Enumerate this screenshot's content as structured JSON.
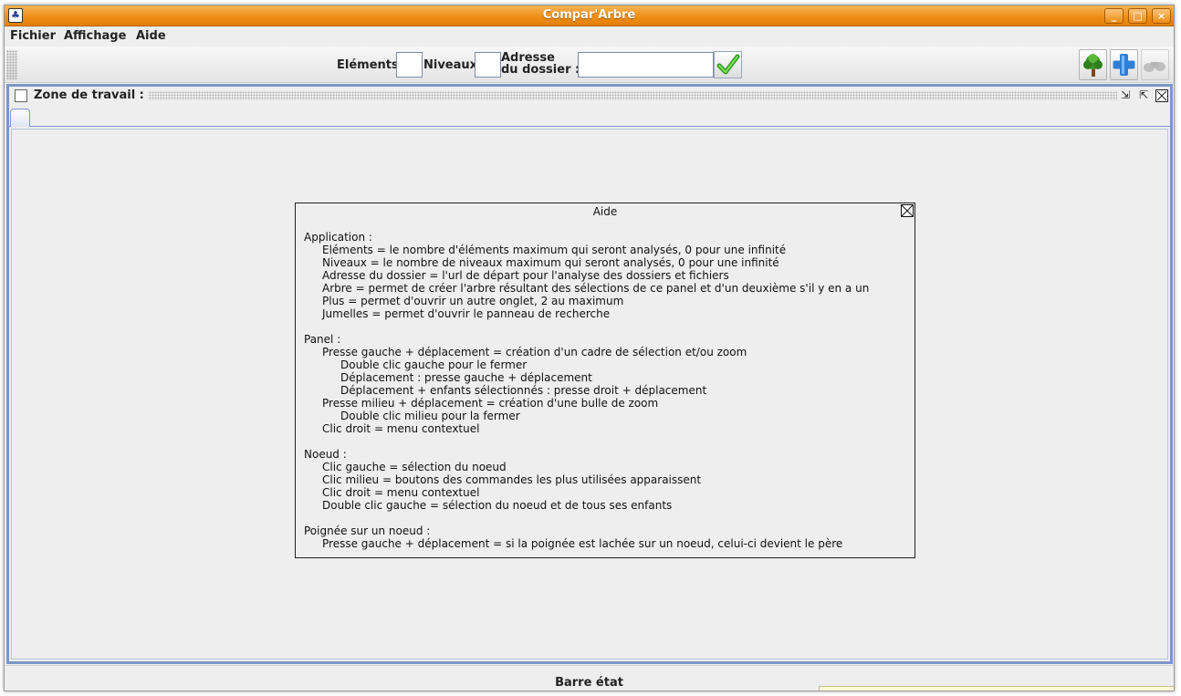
{
  "window": {
    "title": "Compar'Arbre",
    "controls": {
      "minimize": "_",
      "maximize": "□",
      "close": "×"
    }
  },
  "menubar": {
    "items": [
      {
        "label": "Fichier"
      },
      {
        "label": "Affichage"
      },
      {
        "label": "Aide"
      }
    ]
  },
  "toolbar": {
    "elements_label": "Eléments",
    "elements_value": "",
    "niveaux_label": "Niveaux",
    "niveaux_value": "",
    "adresse_label_line1": "Adresse",
    "adresse_label_line2": "du dossier :",
    "adresse_value": "",
    "validate_icon": "check-icon",
    "buttons": [
      {
        "name": "tree-icon"
      },
      {
        "name": "plus-icon"
      },
      {
        "name": "binoculars-icon"
      }
    ]
  },
  "workzone": {
    "title": "Zone de travail :"
  },
  "help_dialog": {
    "title": "Aide",
    "sections": [
      {
        "heading": "Application :",
        "lines": [
          {
            "level": 1,
            "text": "Eléments = le nombre d'éléments maximum qui seront analysés, 0 pour une infinité"
          },
          {
            "level": 1,
            "text": "Niveaux = le nombre de niveaux maximum qui seront analysés, 0 pour une infinité"
          },
          {
            "level": 1,
            "text": "Adresse du dossier = l'url de départ pour l'analyse des dossiers et fichiers"
          },
          {
            "level": 1,
            "text": "Arbre = permet de créer l'arbre résultant des sélections de ce panel et d'un deuxième s'il y en a un"
          },
          {
            "level": 1,
            "text": "Plus = permet d'ouvrir un autre onglet, 2 au maximum"
          },
          {
            "level": 1,
            "text": "Jumelles = permet d'ouvrir le panneau de recherche"
          }
        ]
      },
      {
        "heading": "Panel :",
        "lines": [
          {
            "level": 1,
            "text": "Presse gauche + déplacement = création d'un cadre de sélection et/ou zoom"
          },
          {
            "level": 2,
            "text": "Double clic gauche pour le fermer"
          },
          {
            "level": 2,
            "text": "Déplacement : presse gauche + déplacement"
          },
          {
            "level": 2,
            "text": "Déplacement + enfants sélectionnés : presse droit + déplacement"
          },
          {
            "level": 1,
            "text": "Presse milieu + déplacement = création d'une bulle de zoom"
          },
          {
            "level": 2,
            "text": "Double clic milieu pour la fermer"
          },
          {
            "level": 1,
            "text": "Clic droit = menu contextuel"
          }
        ]
      },
      {
        "heading": "Noeud :",
        "lines": [
          {
            "level": 1,
            "text": "Clic gauche = sélection du noeud"
          },
          {
            "level": 1,
            "text": "Clic milieu = boutons des commandes les plus utilisées apparaissent"
          },
          {
            "level": 1,
            "text": "Clic droit = menu contextuel"
          },
          {
            "level": 1,
            "text": "Double clic gauche = sélection du noeud et de tous ses enfants"
          }
        ]
      },
      {
        "heading": "Poignée sur un noeud :",
        "lines": [
          {
            "level": 1,
            "text": "Presse gauche + déplacement = si la poignée est lachée sur un noeud, celui-ci devient le père"
          }
        ]
      }
    ]
  },
  "statusbar": {
    "text": "Barre état"
  }
}
